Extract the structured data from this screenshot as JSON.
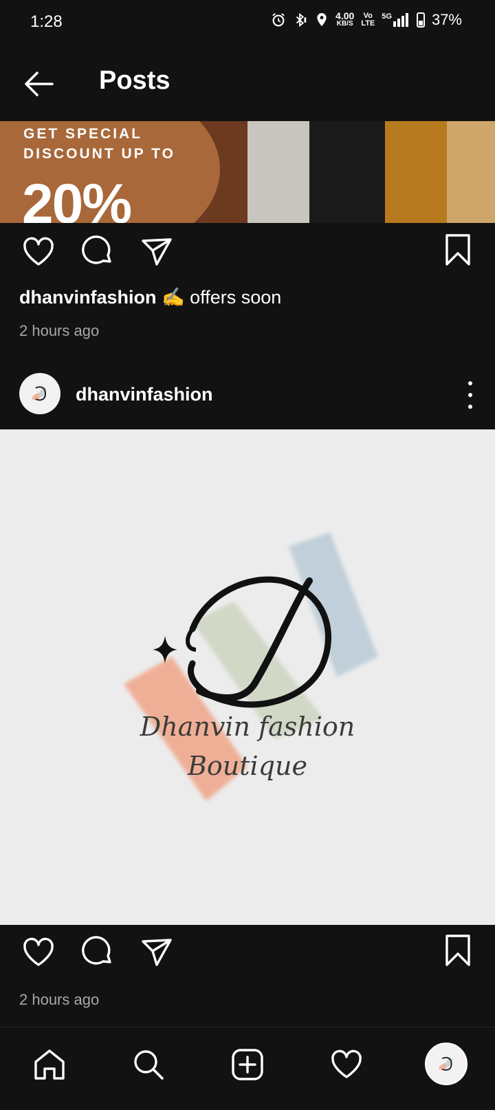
{
  "status_bar": {
    "time": "1:28",
    "net_speed_value": "4.00",
    "net_speed_unit": "KB/S",
    "volte_top": "Vo",
    "volte_bottom": "LTE",
    "network": "5G",
    "battery": "37%"
  },
  "header": {
    "title": "Posts"
  },
  "post1": {
    "banner_line1": "GET SPECIAL",
    "banner_line2": "DISCOUNT UP TO",
    "banner_percent": "20%",
    "username": "dhanvinfashion",
    "emoji": "✍️",
    "caption": "offers soon",
    "time_ago": "2 hours ago"
  },
  "post2": {
    "username": "dhanvinfashion",
    "logo_line1": "Dhanvin fashion",
    "logo_line2": "Boutique",
    "time_ago": "2 hours ago"
  },
  "icons": {
    "like": "heart-icon",
    "comment": "comment-icon",
    "share": "send-icon",
    "save": "bookmark-icon",
    "home": "home-icon",
    "search": "search-icon",
    "create": "plus-square-icon",
    "activity": "heart-icon",
    "profile": "profile-avatar"
  },
  "colors": {
    "background": "#121212",
    "banner_orange": "#a8683a",
    "secondary_text": "#a8a8a8"
  }
}
